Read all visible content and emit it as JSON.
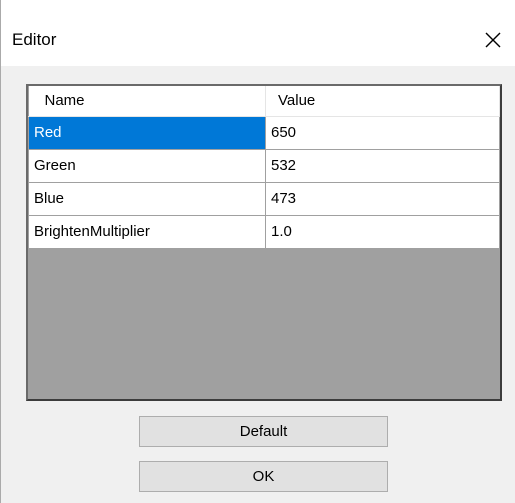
{
  "window": {
    "title": "Editor",
    "close_icon": "close-icon"
  },
  "grid": {
    "columns": [
      "Name",
      "Value"
    ],
    "rows": [
      {
        "name": "Red",
        "value": "650",
        "selected": true
      },
      {
        "name": "Green",
        "value": "532",
        "selected": false
      },
      {
        "name": "Blue",
        "value": "473",
        "selected": false
      },
      {
        "name": "BrightenMultiplier",
        "value": "1.0",
        "selected": false
      }
    ],
    "selection_color": "#0078d7"
  },
  "buttons": {
    "default_label": "Default",
    "ok_label": "OK"
  }
}
